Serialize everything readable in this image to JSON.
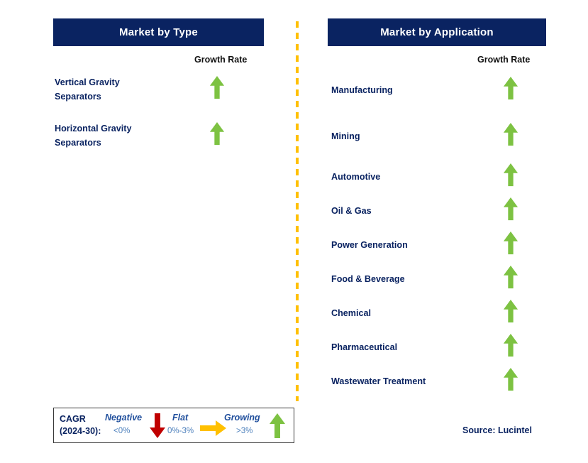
{
  "divider": {
    "color": "#FFC000"
  },
  "colors": {
    "header_bg": "#0A2361",
    "header_text": "#FFFFFF",
    "label_text": "#0A2361",
    "arrow_growing": "#7DC242",
    "arrow_flat": "#FFC000",
    "arrow_negative": "#C00000"
  },
  "columns": [
    {
      "id": "market-by-type",
      "title": "Market by Type",
      "growth_caption": "Growth Rate",
      "items": [
        {
          "label": "Vertical Gravity\nSeparators",
          "trend": "growing",
          "icon": "arrow-up-icon"
        },
        {
          "label": "Horizontal Gravity\nSeparators",
          "trend": "growing",
          "icon": "arrow-up-icon"
        }
      ]
    },
    {
      "id": "market-by-application",
      "title": "Market by Application",
      "growth_caption": "Growth Rate",
      "items": [
        {
          "label": "Manufacturing",
          "trend": "growing",
          "icon": "arrow-up-icon"
        },
        {
          "label": "Mining",
          "trend": "growing",
          "icon": "arrow-up-icon"
        },
        {
          "label": "Automotive",
          "trend": "growing",
          "icon": "arrow-up-icon"
        },
        {
          "label": "Oil & Gas",
          "trend": "growing",
          "icon": "arrow-up-icon"
        },
        {
          "label": "Power Generation",
          "trend": "growing",
          "icon": "arrow-up-icon"
        },
        {
          "label": "Food & Beverage",
          "trend": "growing",
          "icon": "arrow-up-icon"
        },
        {
          "label": "Chemical",
          "trend": "growing",
          "icon": "arrow-up-icon"
        },
        {
          "label": "Pharmaceutical",
          "trend": "growing",
          "icon": "arrow-up-icon"
        },
        {
          "label": "Wastewater Treatment",
          "trend": "growing",
          "icon": "arrow-up-icon"
        }
      ]
    }
  ],
  "legend": {
    "title": "CAGR\n(2024-30):",
    "entries": [
      {
        "name": "Negative",
        "value": "<0%",
        "icon": "arrow-down-icon",
        "color": "#C00000"
      },
      {
        "name": "Flat",
        "value": "0%-3%",
        "icon": "arrow-right-icon",
        "color": "#FFC000"
      },
      {
        "name": "Growing",
        "value": ">3%",
        "icon": "arrow-up-icon",
        "color": "#7DC242"
      }
    ]
  },
  "source": "Source: Lucintel"
}
